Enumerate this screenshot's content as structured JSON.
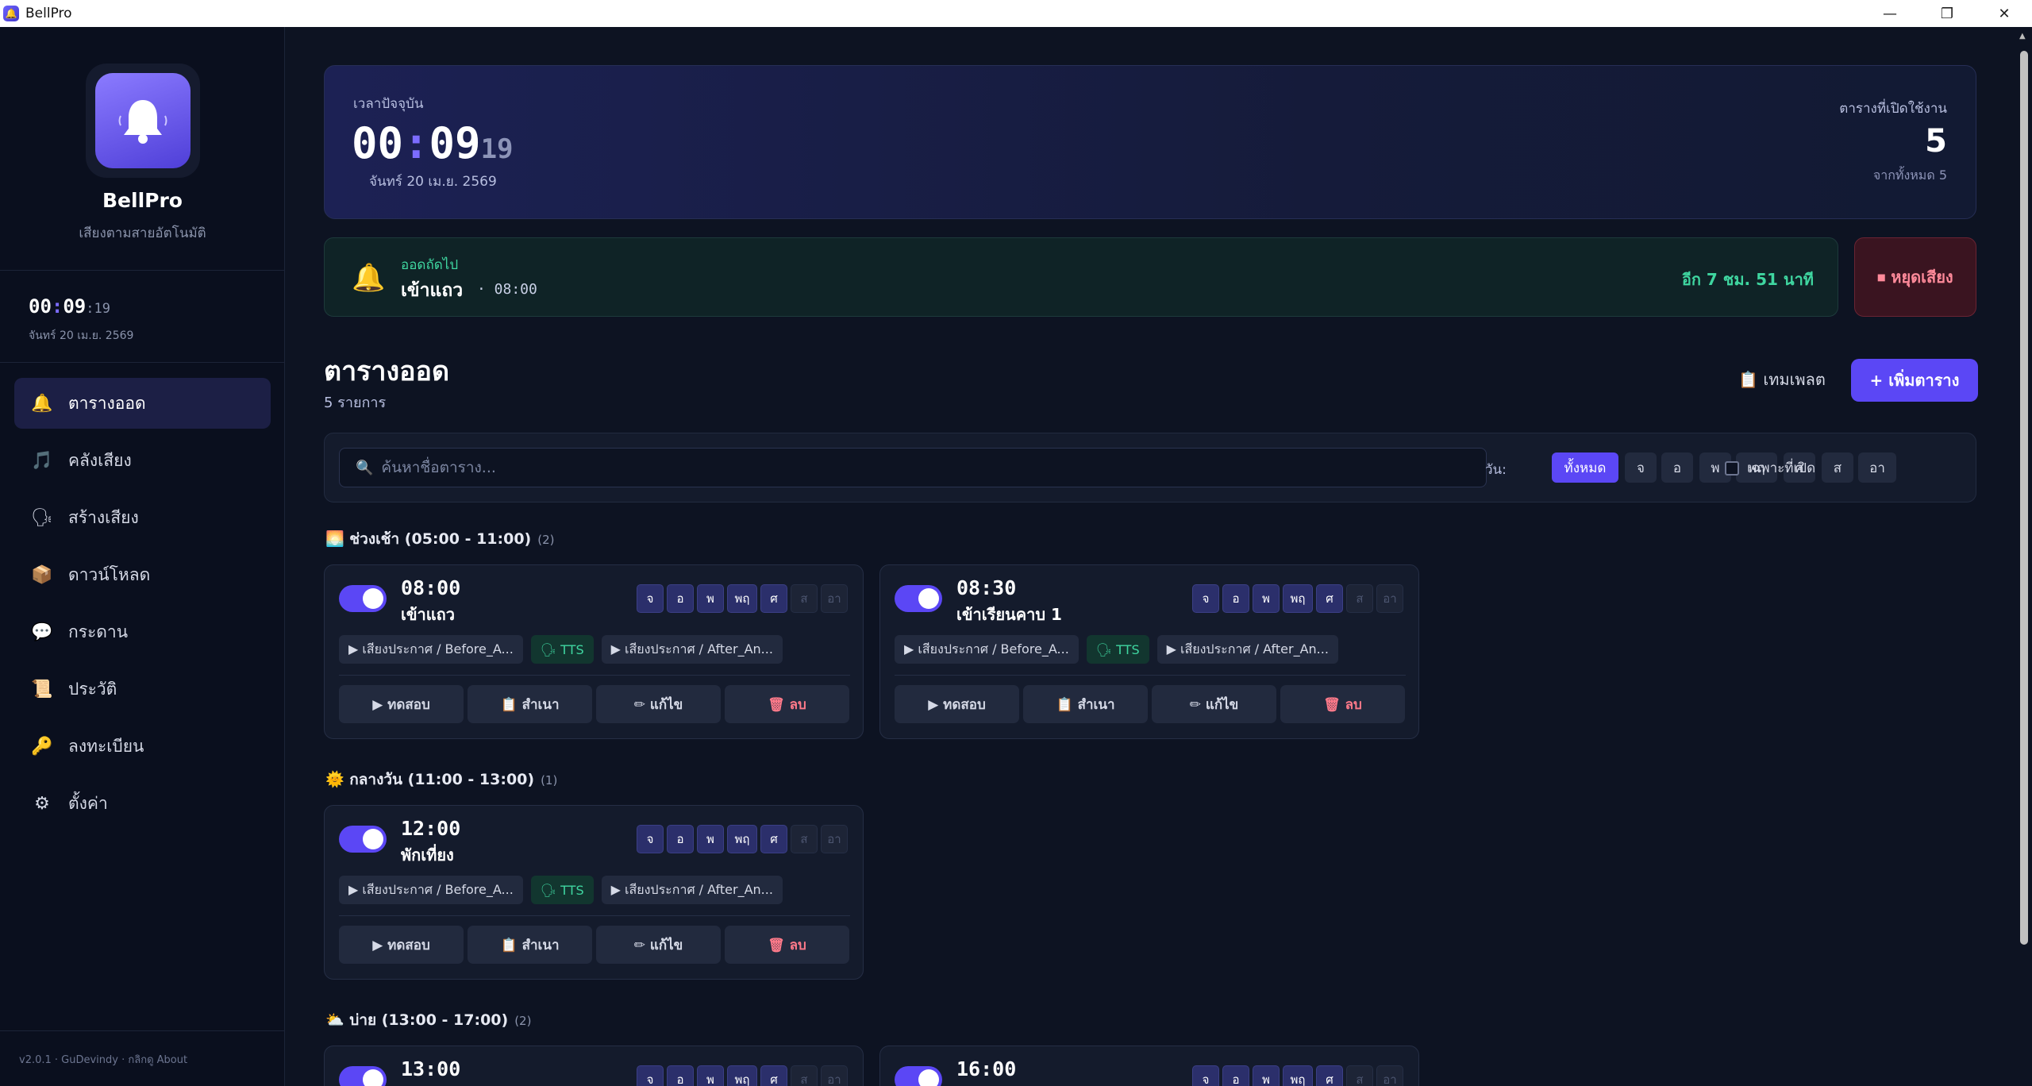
{
  "window": {
    "title": "BellPro",
    "minimize": "—",
    "restore": "❐",
    "close": "✕"
  },
  "sidebar": {
    "brand": "BellPro",
    "tagline": "เสียงตามสายอัตโนมัติ",
    "clock": {
      "hh": "00",
      "mm": "09",
      "ss": "19",
      "sep": ":",
      "sec_sep": ":"
    },
    "date": "จันทร์ 20 เม.ย. 2569",
    "items": [
      {
        "label": "ตารางออด",
        "icon": "🔔"
      },
      {
        "label": "คลังเสียง",
        "icon": "🎵"
      },
      {
        "label": "สร้างเสียง",
        "icon": "🗣"
      },
      {
        "label": "ดาวน์โหลด",
        "icon": "📦"
      },
      {
        "label": "กระดาน",
        "icon": "💬"
      },
      {
        "label": "ประวัติ",
        "icon": "📜"
      },
      {
        "label": "ลงทะเบียน",
        "icon": "🔑"
      },
      {
        "label": "ตั้งค่า",
        "icon": "⚙"
      }
    ],
    "footer": "v2.0.1 · GuDevindy · กลิกดู About"
  },
  "clock_card": {
    "label": "เวลาปัจจุบัน",
    "hh": "00",
    "mm": "09",
    "ss": "19",
    "sep": ":",
    "date": "จันทร์ 20 เม.ย. 2569",
    "active_label": "ตารางที่เปิดใช้งาน",
    "active_count": "5",
    "active_total": "จากทั้งหมด 5"
  },
  "next": {
    "label": "ออดถัดไป",
    "name": "เข้าแถว",
    "time": "· 08:00",
    "remaining": "อีก 7 ชม. 51 นาที",
    "stop_label": "⏹ หยุดเสียง"
  },
  "schedule": {
    "title": "ตารางออด",
    "count": "5 รายการ",
    "template_label": "📋 เทมเพลต",
    "add_label": "+ เพิ่มตาราง"
  },
  "filter": {
    "search_placeholder": "ค้นหาชื่อตาราง...",
    "day_label": "วัน:",
    "days": [
      "ทั้งหมด",
      "จ",
      "อ",
      "พ",
      "พฤ",
      "ศ",
      "ส",
      "อา"
    ],
    "enabled_only": "เฉพาะที่เปิด"
  },
  "groups": [
    {
      "title": "🌅 ช่วงเช้า (05:00 - 11:00)",
      "count": "(2)",
      "cards": [
        {
          "time": "08:00",
          "name": "เข้าแถว",
          "sounds": [
            "▶ เสียงประกาศ / Before_A...",
            "🗣 TTS",
            "▶ เสียงประกาศ / After_An..."
          ]
        },
        {
          "time": "08:30",
          "name": "เข้าเรียนคาบ 1",
          "sounds": [
            "▶ เสียงประกาศ / Before_A...",
            "🗣 TTS",
            "▶ เสียงประกาศ / After_An..."
          ]
        }
      ]
    },
    {
      "title": "🌞 กลางวัน (11:00 - 13:00)",
      "count": "(1)",
      "cards": [
        {
          "time": "12:00",
          "name": "พักเที่ยง",
          "sounds": [
            "▶ เสียงประกาศ / Before_A...",
            "🗣 TTS",
            "▶ เสียงประกาศ / After_An..."
          ]
        }
      ]
    },
    {
      "title": "⛅ บ่าย (13:00 - 17:00)",
      "count": "(2)",
      "cards": [
        {
          "time": "13:00"
        },
        {
          "time": "16:00"
        }
      ]
    }
  ],
  "card_days": [
    "จ",
    "อ",
    "พ",
    "พฤ",
    "ศ",
    "ส",
    "อา"
  ],
  "card_actions": {
    "test": "▶ ทดสอบ",
    "copy": "📋 สำเนา",
    "edit": "✏ แก้ไข",
    "delete": "🗑 ลบ"
  }
}
